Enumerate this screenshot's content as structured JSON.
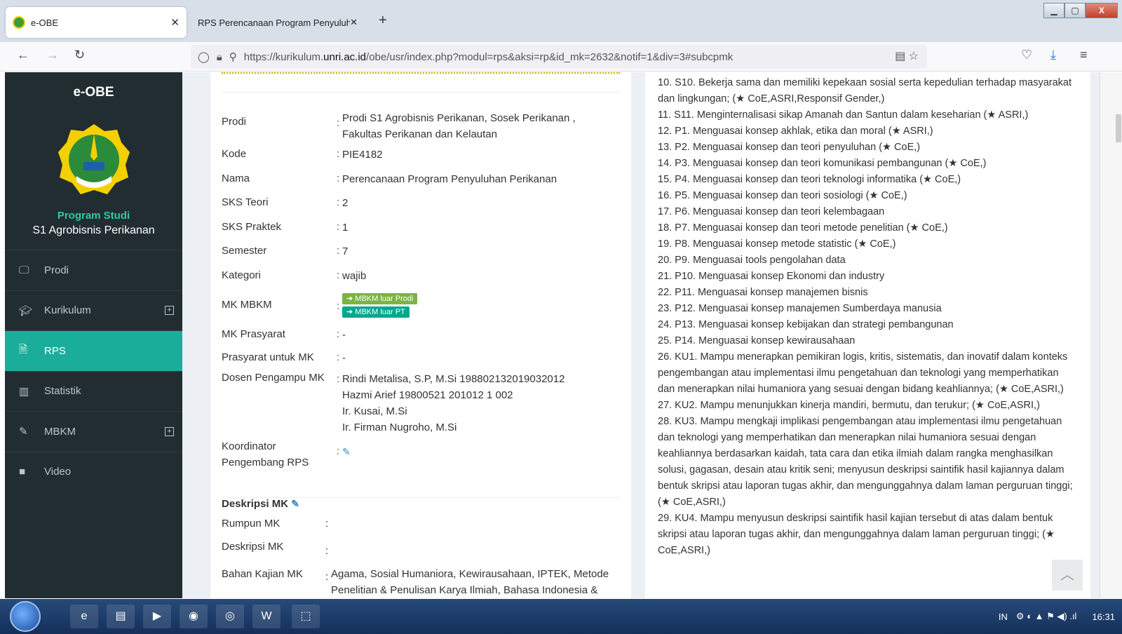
{
  "browser": {
    "tab1": "e-OBE",
    "tab2": "RPS Perencanaan Program Penyuluh",
    "url_pre": "https://kurikulum.",
    "url_dom": "unri.ac.id",
    "url_post": "/obe/usr/index.php?modul=rps&aksi=rp&id_mk=2632&notif=1&div=3#subcpmk"
  },
  "sidebar": {
    "brand": "e-OBE",
    "ps_label": "Program Studi",
    "ps_name": "S1 Agrobisnis Perikanan",
    "items": [
      {
        "label": "Prodi",
        "icon": "monitor-icon"
      },
      {
        "label": "Kurikulum",
        "icon": "graduation-cap-icon"
      },
      {
        "label": "RPS",
        "icon": "file-icon"
      },
      {
        "label": "Statistik",
        "icon": "bar-chart-icon"
      },
      {
        "label": "MBKM",
        "icon": "pen-icon"
      },
      {
        "label": "Video",
        "icon": "video-icon"
      }
    ]
  },
  "info": {
    "prodi_l": "Prodi",
    "prodi_v": "Prodi S1 Agrobisnis Perikanan, Sosek Perikanan , Fakultas Perikanan dan Kelautan",
    "kode_l": "Kode",
    "kode_v": "PIE4182",
    "nama_l": "Nama",
    "nama_v": "Perencanaan Program Penyuluhan Perikanan",
    "sks_t_l": "SKS Teori",
    "sks_t_v": "2",
    "sks_p_l": "SKS Praktek",
    "sks_p_v": "1",
    "sem_l": "Semester",
    "sem_v": "7",
    "kat_l": "Kategori",
    "kat_v": "wajib",
    "mbkm_l": "MK MBKM",
    "mbkm_b1": "MBKM luar Prodi",
    "mbkm_b2": "MBKM luar PT",
    "pras_l": "MK Prasyarat",
    "pras_v": "-",
    "prasu_l": "Prasyarat untuk MK",
    "prasu_v": "-",
    "dosen_l": "Dosen Pengampu MK",
    "dosen": [
      "Rindi Metalisa, S.P, M.Si 198802132019032012",
      "Hazmi Arief 19800521 201012 1 002",
      "Ir. Kusai, M.Si",
      "Ir. Firman Nugroho, M.Si"
    ],
    "koord_l1": "Koordinator",
    "koord_l2": "Pengembang RPS"
  },
  "desk": {
    "title": "Deskripsi MK",
    "rumpun_l": "Rumpun MK",
    "desk_l": "Deskripsi MK",
    "bahan_l": "Bahan Kajian MK",
    "bahan_v": "Agama, Sosial Humaniora, Kewirausahaan, IPTEK, Metode Penelitian & Penulisan Karya Ilmiah, Bahasa Indonesia &"
  },
  "cpl": [
    "10. S10. Bekerja sama dan memiliki kepekaan sosial serta kepedulian terhadap masyarakat dan lingkungan; (★ CoE,ASRI,Responsif Gender,)",
    "11. S11. Menginternalisasi sikap Amanah dan Santun dalam keseharian (★ ASRI,)",
    "12. P1. Menguasai konsep akhlak, etika dan moral (★ ASRI,)",
    "13. P2. Menguasai konsep dan teori penyuluhan (★ CoE,)",
    "14. P3. Menguasai konsep dan teori komunikasi pembangunan (★ CoE,)",
    "15. P4. Menguasai konsep dan teori teknologi informatika (★ CoE,)",
    "16. P5. Menguasai konsep dan teori sosiologi (★ CoE,)",
    "17. P6. Menguasai konsep dan teori kelembagaan",
    "18. P7. Menguasai konsep dan teori metode penelitian (★ CoE,)",
    "19. P8. Menguasai konsep metode statistic (★ CoE,)",
    "20. P9. Menguasai tools pengolahan data",
    "21. P10. Menguasai konsep Ekonomi dan industry",
    "22. P11. Menguasai konsep manajemen bisnis",
    "23. P12. Menguasai konsep manajemen Sumberdaya manusia",
    "24. P13. Menguasai konsep kebijakan dan strategi pembangunan",
    "25. P14. Menguasai konsep kewirausahaan",
    "26. KU1. Mampu menerapkan pemikiran logis, kritis, sistematis, dan inovatif dalam konteks pengembangan atau implementasi ilmu pengetahuan dan teknologi yang memperhatikan dan menerapkan nilai humaniora yang sesuai dengan bidang keahliannya; (★ CoE,ASRI,)",
    "27. KU2. Mampu menunjukkan kinerja mandiri, bermutu, dan terukur; (★ CoE,ASRI,)",
    "28. KU3. Mampu mengkaji implikasi pengembangan atau implementasi ilmu pengetahuan dan teknologi yang memperhatikan dan menerapkan nilai humaniora sesuai dengan keahliannya berdasarkan kaidah, tata cara dan etika ilmiah dalam rangka menghasilkan solusi, gagasan, desain atau kritik seni; menyusun deskripsi saintifik hasil kajiannya dalam bentuk skripsi atau laporan tugas akhir, dan mengunggahnya dalam laman perguruan tinggi; (★ CoE,ASRI,)",
    "29. KU4. Mampu menyusun deskripsi saintifik hasil kajian tersebut di atas dalam bentuk skripsi atau laporan tugas akhir, dan mengunggahnya dalam laman perguruan tinggi; (★ CoE,ASRI,)"
  ],
  "taskbar": {
    "lang": "IN",
    "time": "16:31"
  }
}
